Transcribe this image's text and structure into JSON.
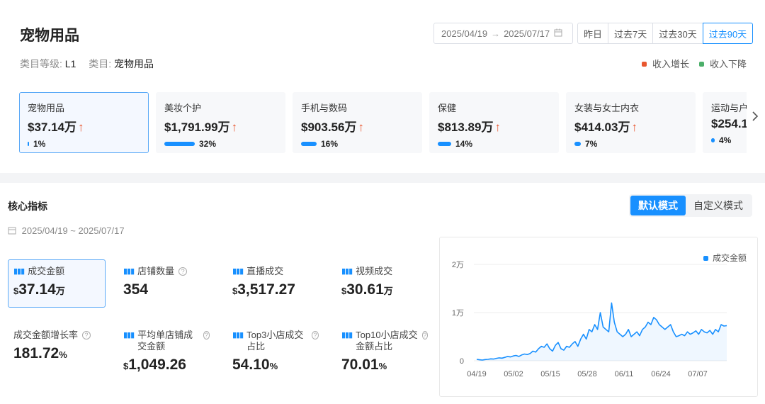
{
  "header": {
    "title": "宠物用品",
    "level_label": "类目等级:",
    "level_value": "L1",
    "cat_label": "类目:",
    "cat_value": "宠物用品",
    "date_start": "2025/04/19",
    "date_arrow": "→",
    "date_end": "2025/07/17",
    "ranges": [
      "昨日",
      "过去7天",
      "过去30天",
      "过去90天"
    ],
    "active_range": "过去90天",
    "legend": [
      {
        "label": "收入增长",
        "color": "#e8572f"
      },
      {
        "label": "收入下降",
        "color": "#4caf6a"
      }
    ]
  },
  "categories": [
    {
      "name": "宠物用品",
      "value": "$37.14万",
      "pct": "1%",
      "ratio": 0.01,
      "active": true
    },
    {
      "name": "美妆个护",
      "value": "$1,791.99万",
      "pct": "32%",
      "ratio": 0.32
    },
    {
      "name": "手机与数码",
      "value": "$903.56万",
      "pct": "16%",
      "ratio": 0.16
    },
    {
      "name": "保健",
      "value": "$813.89万",
      "pct": "14%",
      "ratio": 0.14
    },
    {
      "name": "女装与女士内衣",
      "value": "$414.03万",
      "pct": "7%",
      "ratio": 0.07
    },
    {
      "name": "运动与户外",
      "value": "$254.1",
      "pct": "4%",
      "ratio": 0.04
    }
  ],
  "core": {
    "title": "核心指标",
    "modes": [
      "默认模式",
      "自定义模式"
    ],
    "active_mode": "默认模式",
    "date": "2025/04/19 ~ 2025/07/17",
    "metrics": [
      {
        "label": "成交金额",
        "cur": "$",
        "num": "37.14",
        "unit": "万",
        "icon": true,
        "help": false,
        "active": true
      },
      {
        "label": "店铺数量",
        "cur": "",
        "num": "354",
        "unit": "",
        "icon": true,
        "help": true
      },
      {
        "label": "直播成交",
        "cur": "$",
        "num": "3,517.27",
        "unit": "",
        "icon": true,
        "help": false
      },
      {
        "label": "视频成交",
        "cur": "$",
        "num": "30.61",
        "unit": "万",
        "icon": true,
        "help": false
      },
      {
        "label": "成交金额增长率",
        "cur": "",
        "num": "181.72",
        "unit": "%",
        "icon": false,
        "help": true
      },
      {
        "label": "平均单店铺成交金额",
        "cur": "$",
        "num": "1,049.26",
        "unit": "",
        "icon": true,
        "help": true
      },
      {
        "label": "Top3小店成交占比",
        "cur": "",
        "num": "54.10",
        "unit": "%",
        "icon": true,
        "help": true
      },
      {
        "label": "Top10小店成交金额占比",
        "cur": "",
        "num": "70.01",
        "unit": "%",
        "icon": true,
        "help": true
      }
    ]
  },
  "chart_data": {
    "type": "area",
    "series": [
      {
        "name": "成交金额",
        "color": "#1890ff"
      }
    ],
    "y_ticks": [
      "2万",
      "1万",
      "0"
    ],
    "ylim": [
      0,
      20000
    ],
    "x_ticks": [
      "04/19",
      "05/02",
      "05/15",
      "05/28",
      "06/11",
      "06/24",
      "07/07"
    ],
    "values": [
      300,
      200,
      150,
      250,
      300,
      400,
      350,
      500,
      600,
      550,
      700,
      900,
      800,
      1000,
      1100,
      900,
      1200,
      1400,
      1300,
      1500,
      2000,
      1800,
      2500,
      3000,
      2800,
      3500,
      2500,
      2000,
      3200,
      3800,
      2500,
      2200,
      3000,
      2800,
      3500,
      4000,
      3000,
      4500,
      5500,
      4500,
      6500,
      6000,
      7500,
      6500,
      10000,
      7000,
      6500,
      6000,
      12000,
      8000,
      6000,
      5500,
      5000,
      5500,
      6500,
      5000,
      5500,
      6000,
      5200,
      6500,
      7000,
      8000,
      7500,
      9000,
      8500,
      7500,
      7000,
      6500,
      7000,
      7500,
      6000,
      5000,
      5200,
      5500,
      5200,
      6000,
      5500,
      5800,
      6200,
      5500,
      6500,
      6000,
      5800,
      6300,
      5500,
      6500,
      6000,
      7500,
      7200,
      7300
    ]
  }
}
